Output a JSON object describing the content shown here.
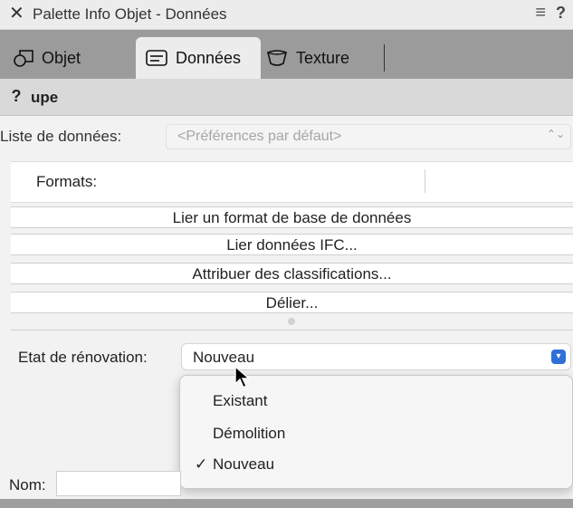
{
  "window": {
    "title": "Palette Info Objet - Données",
    "close_glyph": "✕",
    "menu_glyph": "≡",
    "help_glyph": "?"
  },
  "tabs": [
    {
      "label": "Objet",
      "icon": "objet-icon",
      "active": false
    },
    {
      "label": "Données",
      "icon": "donnees-icon",
      "active": true
    },
    {
      "label": "Texture",
      "icon": "texture-icon",
      "active": false
    }
  ],
  "group": {
    "help_glyph": "?",
    "label": "upe"
  },
  "liste": {
    "label": "Liste de données:",
    "placeholder": "<Préférences par défaut>"
  },
  "formats": {
    "label": "Formats:"
  },
  "buttons": {
    "link_format": "Lier un format de base de données",
    "link_ifc": "Lier données IFC...",
    "classify": "Attribuer des classifications...",
    "unlink": "Délier..."
  },
  "renovation": {
    "label": "Etat de rénovation:",
    "value": "Nouveau",
    "options": [
      "Existant",
      "Démolition",
      "Nouveau"
    ],
    "checkmark": "✓",
    "accent": "#2f6fd6"
  },
  "nom": {
    "label": "Nom:",
    "value": ""
  }
}
